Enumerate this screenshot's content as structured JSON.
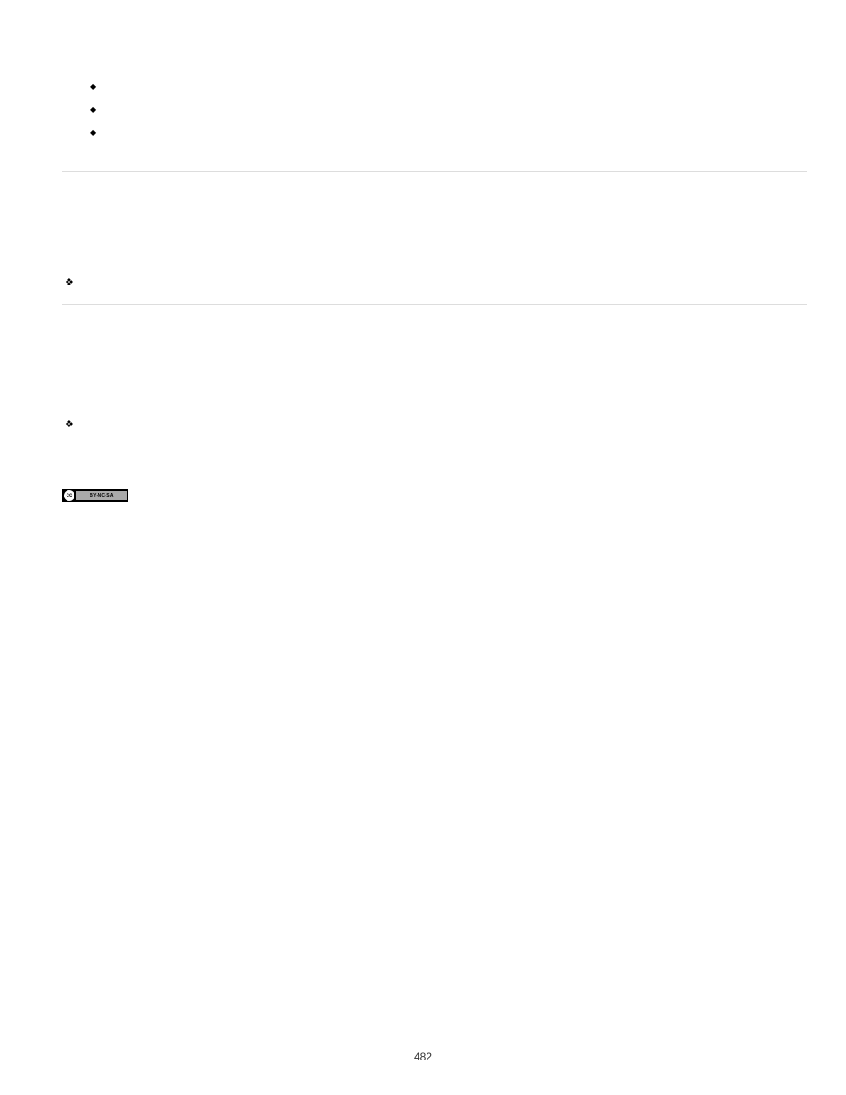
{
  "bullets": {
    "items": [
      "",
      "",
      ""
    ]
  },
  "diamond1": "",
  "diamond2": "",
  "license_badge": {
    "cc_symbol": "cc",
    "text": "BY-NC-SA"
  },
  "page_number": "482"
}
